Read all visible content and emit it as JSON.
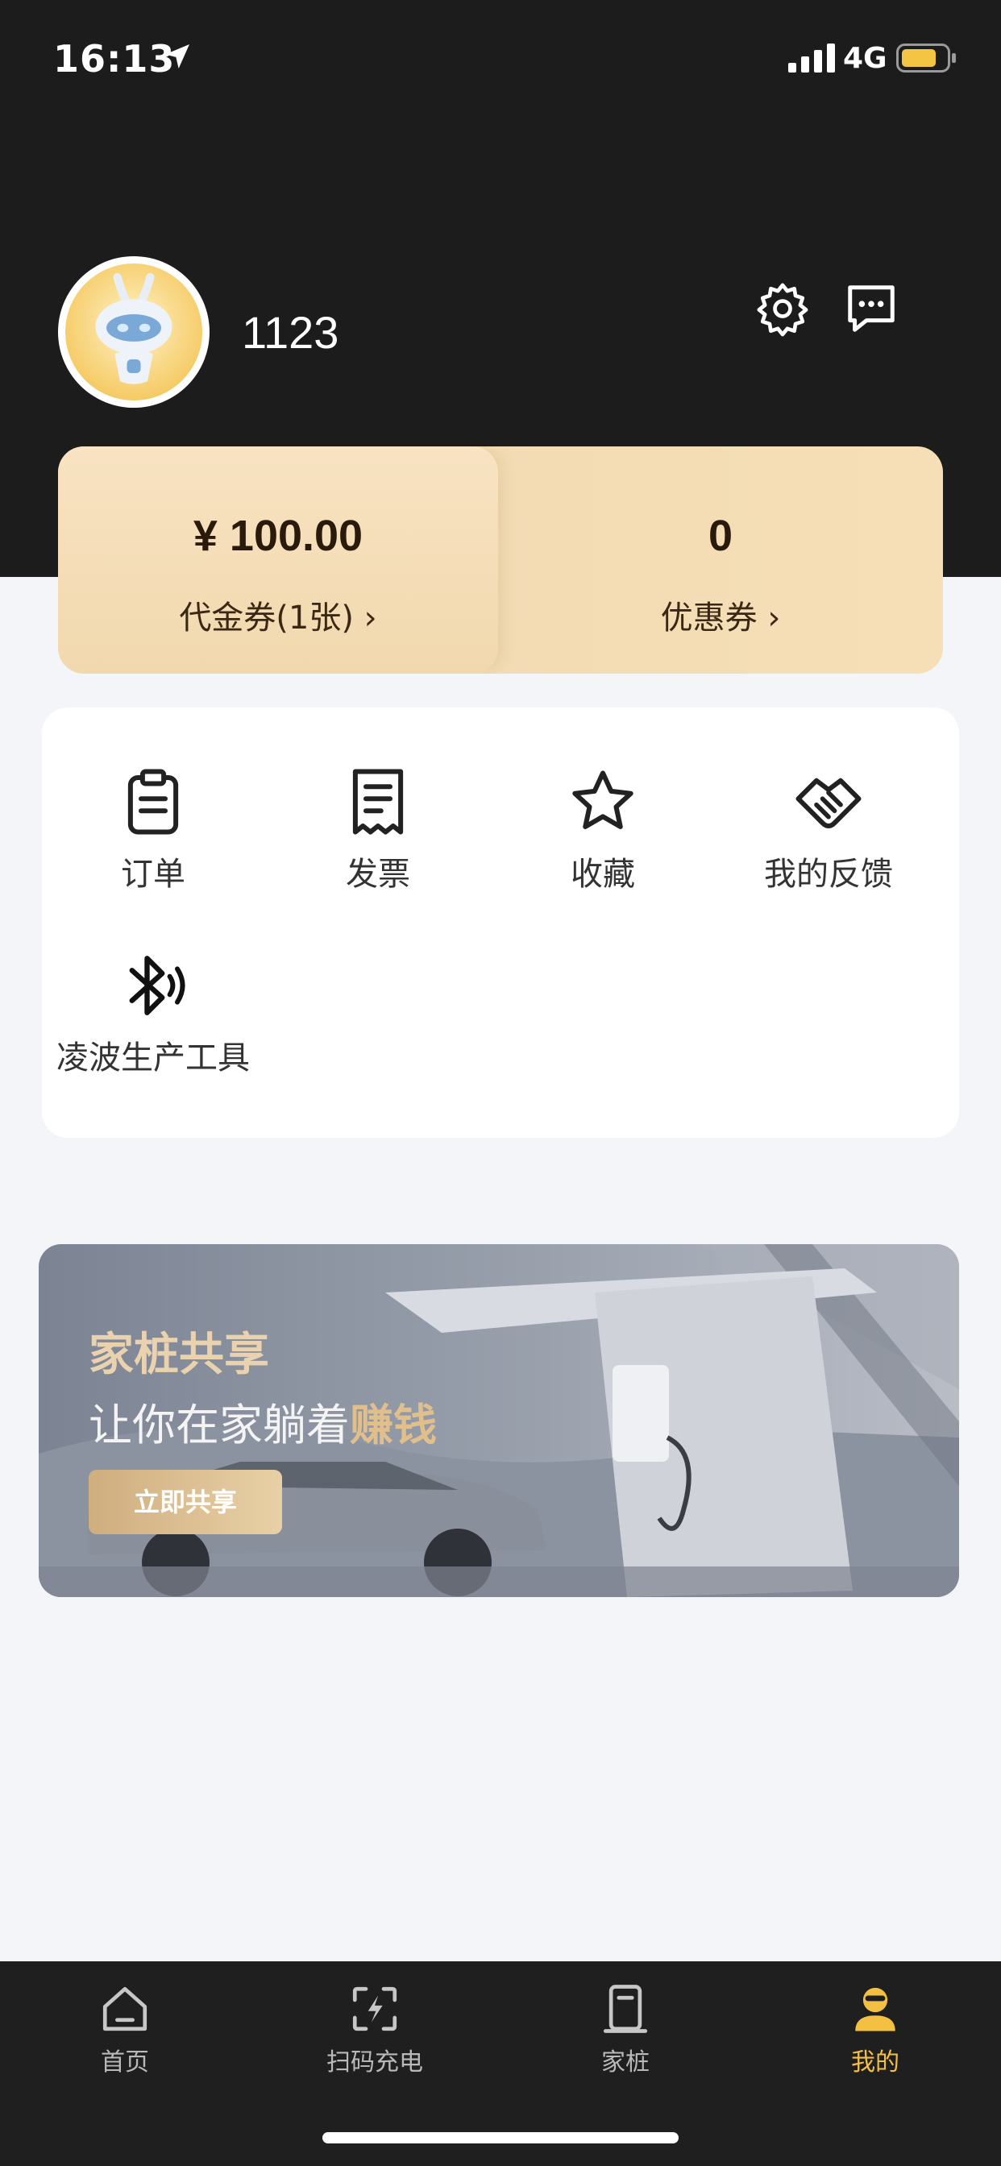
{
  "status_bar": {
    "time": "16:13",
    "network": "4G"
  },
  "profile": {
    "username": "1123"
  },
  "wallet": {
    "voucher_amount": "¥ 100.00",
    "voucher_label": "代金券(1张) ›",
    "coupon_count": "0",
    "coupon_label": "优惠券 ›"
  },
  "menu": {
    "items": [
      {
        "label": "订单",
        "icon": "clipboard-icon"
      },
      {
        "label": "发票",
        "icon": "receipt-icon"
      },
      {
        "label": "收藏",
        "icon": "star-icon"
      },
      {
        "label": "我的反馈",
        "icon": "handshake-icon"
      },
      {
        "label": "凌波生产工具",
        "icon": "bluetooth-icon"
      }
    ]
  },
  "banner": {
    "title": "家桩共享",
    "subtitle_prefix": "让你在家躺着",
    "subtitle_highlight": "赚钱",
    "button_label": "立即共享"
  },
  "tab_bar": {
    "tabs": [
      {
        "label": "首页",
        "icon": "home-icon"
      },
      {
        "label": "扫码充电",
        "icon": "scan-charge-icon"
      },
      {
        "label": "家桩",
        "icon": "charger-icon"
      },
      {
        "label": "我的",
        "icon": "profile-icon",
        "active": true
      }
    ]
  },
  "colors": {
    "header_bg": "#1c1c1c",
    "accent_gold": "#f3c041",
    "card_gold": "#f3dcb4",
    "tab_bar_bg": "#1f1f1f"
  }
}
